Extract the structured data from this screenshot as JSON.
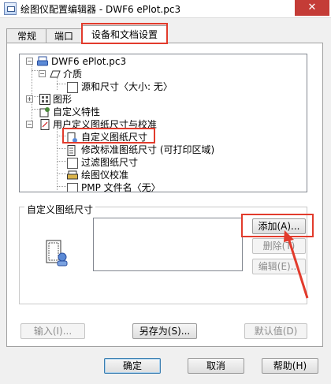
{
  "window": {
    "title": "绘图仪配置编辑器 - DWF6 ePlot.pc3",
    "close_label": "✕"
  },
  "tabs": [
    {
      "label": "常规"
    },
    {
      "label": "端口"
    },
    {
      "label": "设备和文档设置"
    }
  ],
  "tree": {
    "items": [
      {
        "label": "DWF6 ePlot.pc3"
      },
      {
        "label": "介质"
      },
      {
        "label": "源和尺寸〈大小: 无〉"
      },
      {
        "label": "图形"
      },
      {
        "label": "自定义特性"
      },
      {
        "label": "用户定义图纸尺寸与校准"
      },
      {
        "label": "自定义图纸尺寸"
      },
      {
        "label": "修改标准图纸尺寸 (可打印区域)"
      },
      {
        "label": "过滤图纸尺寸"
      },
      {
        "label": "绘图仪校准"
      },
      {
        "label": "PMP 文件名〈无〉"
      }
    ]
  },
  "custom_paper": {
    "group_label": "自定义图纸尺寸",
    "add_label": "添加(A)...",
    "delete_label": "删除(T)",
    "edit_label": "编辑(E)..."
  },
  "bottom_row": {
    "import_label": "输入(I)...",
    "saveas_label": "另存为(S)...",
    "defaults_label": "默认值(D)"
  },
  "dialog_buttons": {
    "ok_label": "确定",
    "cancel_label": "取消",
    "help_label": "帮助(H)"
  },
  "colors": {
    "highlight_red": "#e23b2c",
    "close_red": "#c43c37"
  }
}
